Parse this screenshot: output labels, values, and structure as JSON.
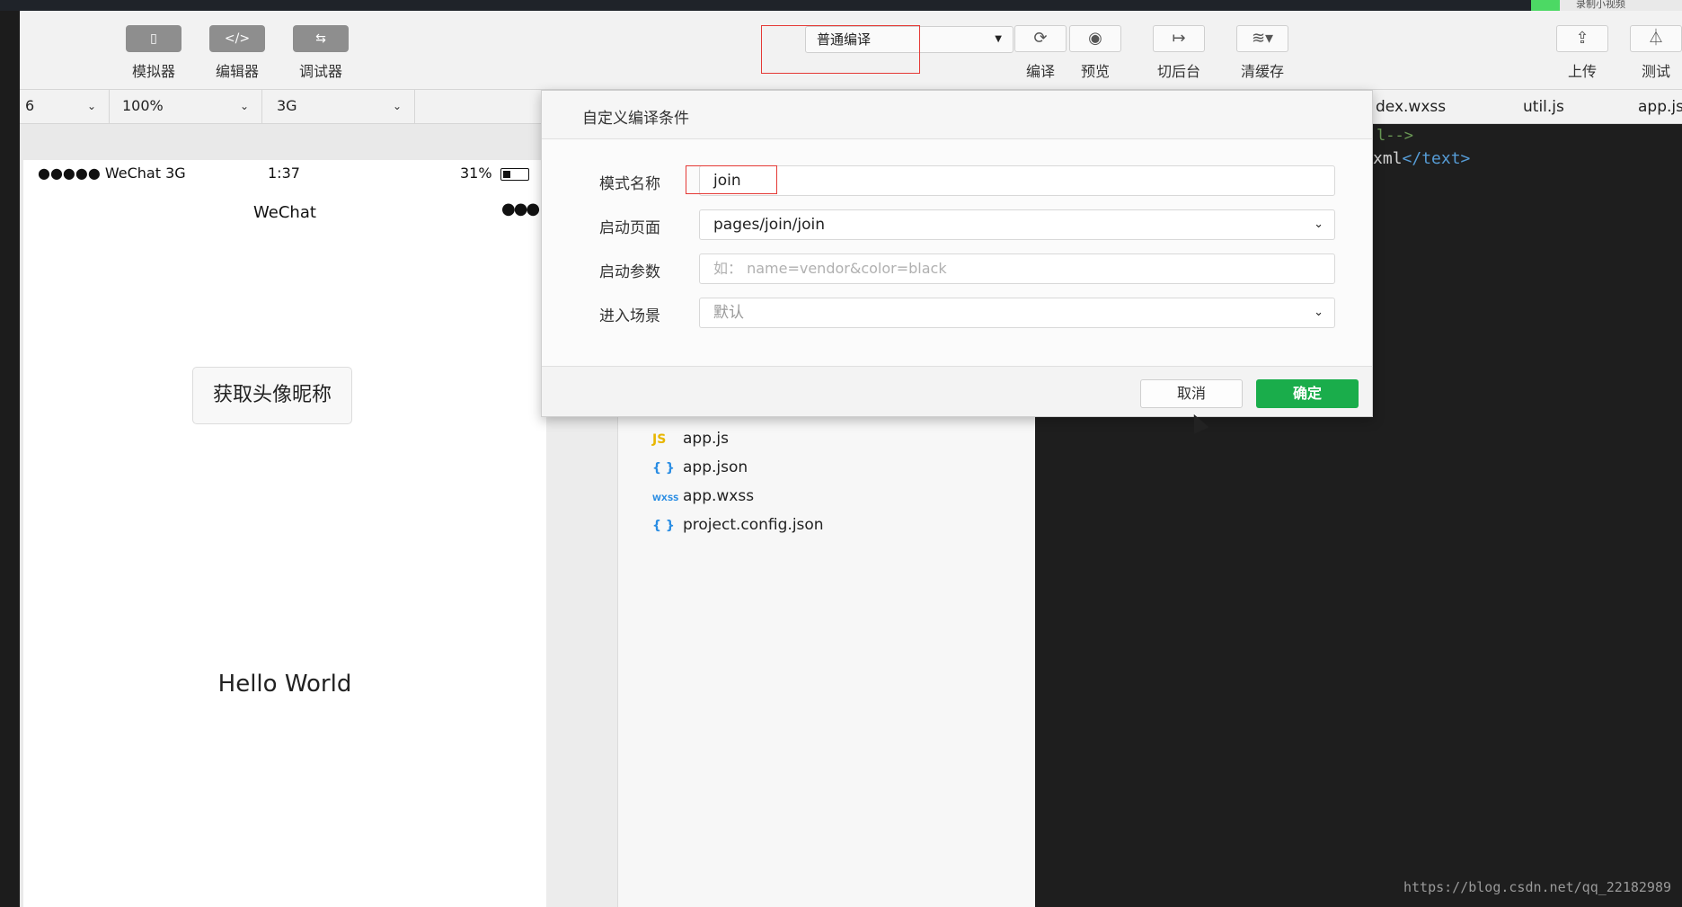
{
  "recording": {
    "label": "录制小视频"
  },
  "toolbar": {
    "modes": [
      {
        "label": "模拟器",
        "icon": "phone-icon"
      },
      {
        "label": "编辑器",
        "icon": "code-icon"
      },
      {
        "label": "调试器",
        "icon": "debug-icon"
      }
    ],
    "compile_mode": "普通编译",
    "actions": [
      {
        "label": "编译",
        "icon": "refresh-icon"
      },
      {
        "label": "预览",
        "icon": "eye-icon"
      },
      {
        "label": "切后台",
        "icon": "switch-background-icon"
      },
      {
        "label": "清缓存",
        "icon": "layers-icon"
      },
      {
        "label": "上传",
        "icon": "upload-icon"
      },
      {
        "label": "测试",
        "icon": "flask-icon"
      }
    ]
  },
  "simulator": {
    "device": "6",
    "zoom": "100%",
    "network": "3G",
    "status": {
      "carrier": "●●●●● WeChat 3G",
      "time": "1:37",
      "battery": "31%"
    },
    "nav_title": "WeChat",
    "nav_dots": "●●●",
    "button_label": "获取头像昵称",
    "hello_text": "Hello World"
  },
  "file_tree": [
    {
      "type": "JS",
      "name": "app.js"
    },
    {
      "type": "{ }",
      "name": "app.json"
    },
    {
      "type": "WXSS",
      "name": "app.wxss"
    },
    {
      "type": "{ }",
      "name": "project.config.json"
    }
  ],
  "editor": {
    "tabs": [
      "dex.wxss",
      "util.js",
      "app.js"
    ],
    "code_line_1": "l-->",
    "code_line_2_text": "xml",
    "code_line_2_tag": "</text>"
  },
  "dialog": {
    "title": "自定义编译条件",
    "mode_name": {
      "label": "模式名称",
      "value": "join"
    },
    "start_page": {
      "label": "启动页面",
      "value": "pages/join/join"
    },
    "start_params": {
      "label": "启动参数",
      "placeholder": "如： name=vendor&color=black"
    },
    "scene": {
      "label": "进入场景",
      "value": "默认"
    },
    "cancel_label": "取消",
    "ok_label": "确定"
  },
  "watermark": "https://blog.csdn.net/qq_22182989",
  "colors": {
    "accent_green": "#1aad4b",
    "highlight_red": "#e53935"
  }
}
